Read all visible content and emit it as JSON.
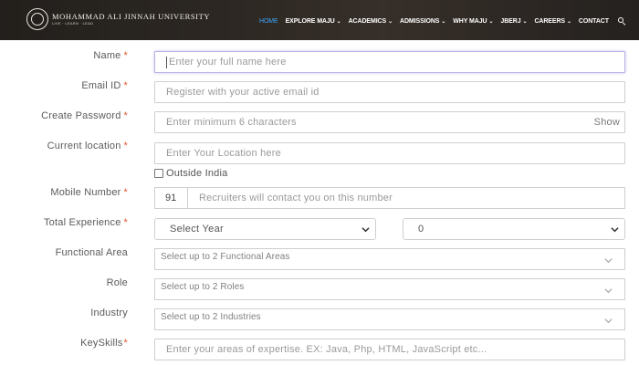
{
  "header": {
    "logo_name": "MOHAMMAD ALI JINNAH UNIVERSITY",
    "logo_sub": "LIVE · LEARN · LEAD",
    "nav": [
      {
        "label": "HOME",
        "active": true
      },
      {
        "label": "EXPLORE MAJU",
        "caret": "⌄"
      },
      {
        "label": "ACADEMICS",
        "caret": "⌄"
      },
      {
        "label": "ADMISSIONS",
        "caret": "⌄"
      },
      {
        "label": "WHY MAJU",
        "caret": "⌄"
      },
      {
        "label": "JBERJ",
        "caret": "⌄"
      },
      {
        "label": "CAREERS",
        "caret": "⌄"
      },
      {
        "label": "CONTACT"
      }
    ],
    "accent_color": "#3ea7ff"
  },
  "form": {
    "name": {
      "label": "Name",
      "required": "*",
      "placeholder": "Enter your full name here"
    },
    "email": {
      "label": "Email ID",
      "required": "*",
      "placeholder": "Register with your active email id"
    },
    "password": {
      "label": "Create Password",
      "required": "*",
      "placeholder": "Enter minimum 6 characters",
      "show": "Show"
    },
    "location": {
      "label": "Current location",
      "required": "*",
      "placeholder": "Enter Your Location here"
    },
    "outside_india": {
      "label": "Outside India",
      "checked": false
    },
    "mobile": {
      "label": "Mobile Number",
      "required": "*",
      "country_code": "91",
      "placeholder": "Recruiters will contact you on this number"
    },
    "experience": {
      "label": "Total Experience",
      "required": "*",
      "year_value": "Select Year",
      "month_value": "0"
    },
    "functional_area": {
      "label": "Functional Area",
      "placeholder": "Select up to 2 Functional Areas"
    },
    "role": {
      "label": "Role",
      "placeholder": "Select up to 2 Roles"
    },
    "industry": {
      "label": "Industry",
      "placeholder": "Select up to 2 Industries"
    },
    "keyskills": {
      "label": "KeySkills",
      "required": "*",
      "placeholder": "Enter your areas of expertise. EX: Java, Php, HTML, JavaScript etc..."
    }
  }
}
